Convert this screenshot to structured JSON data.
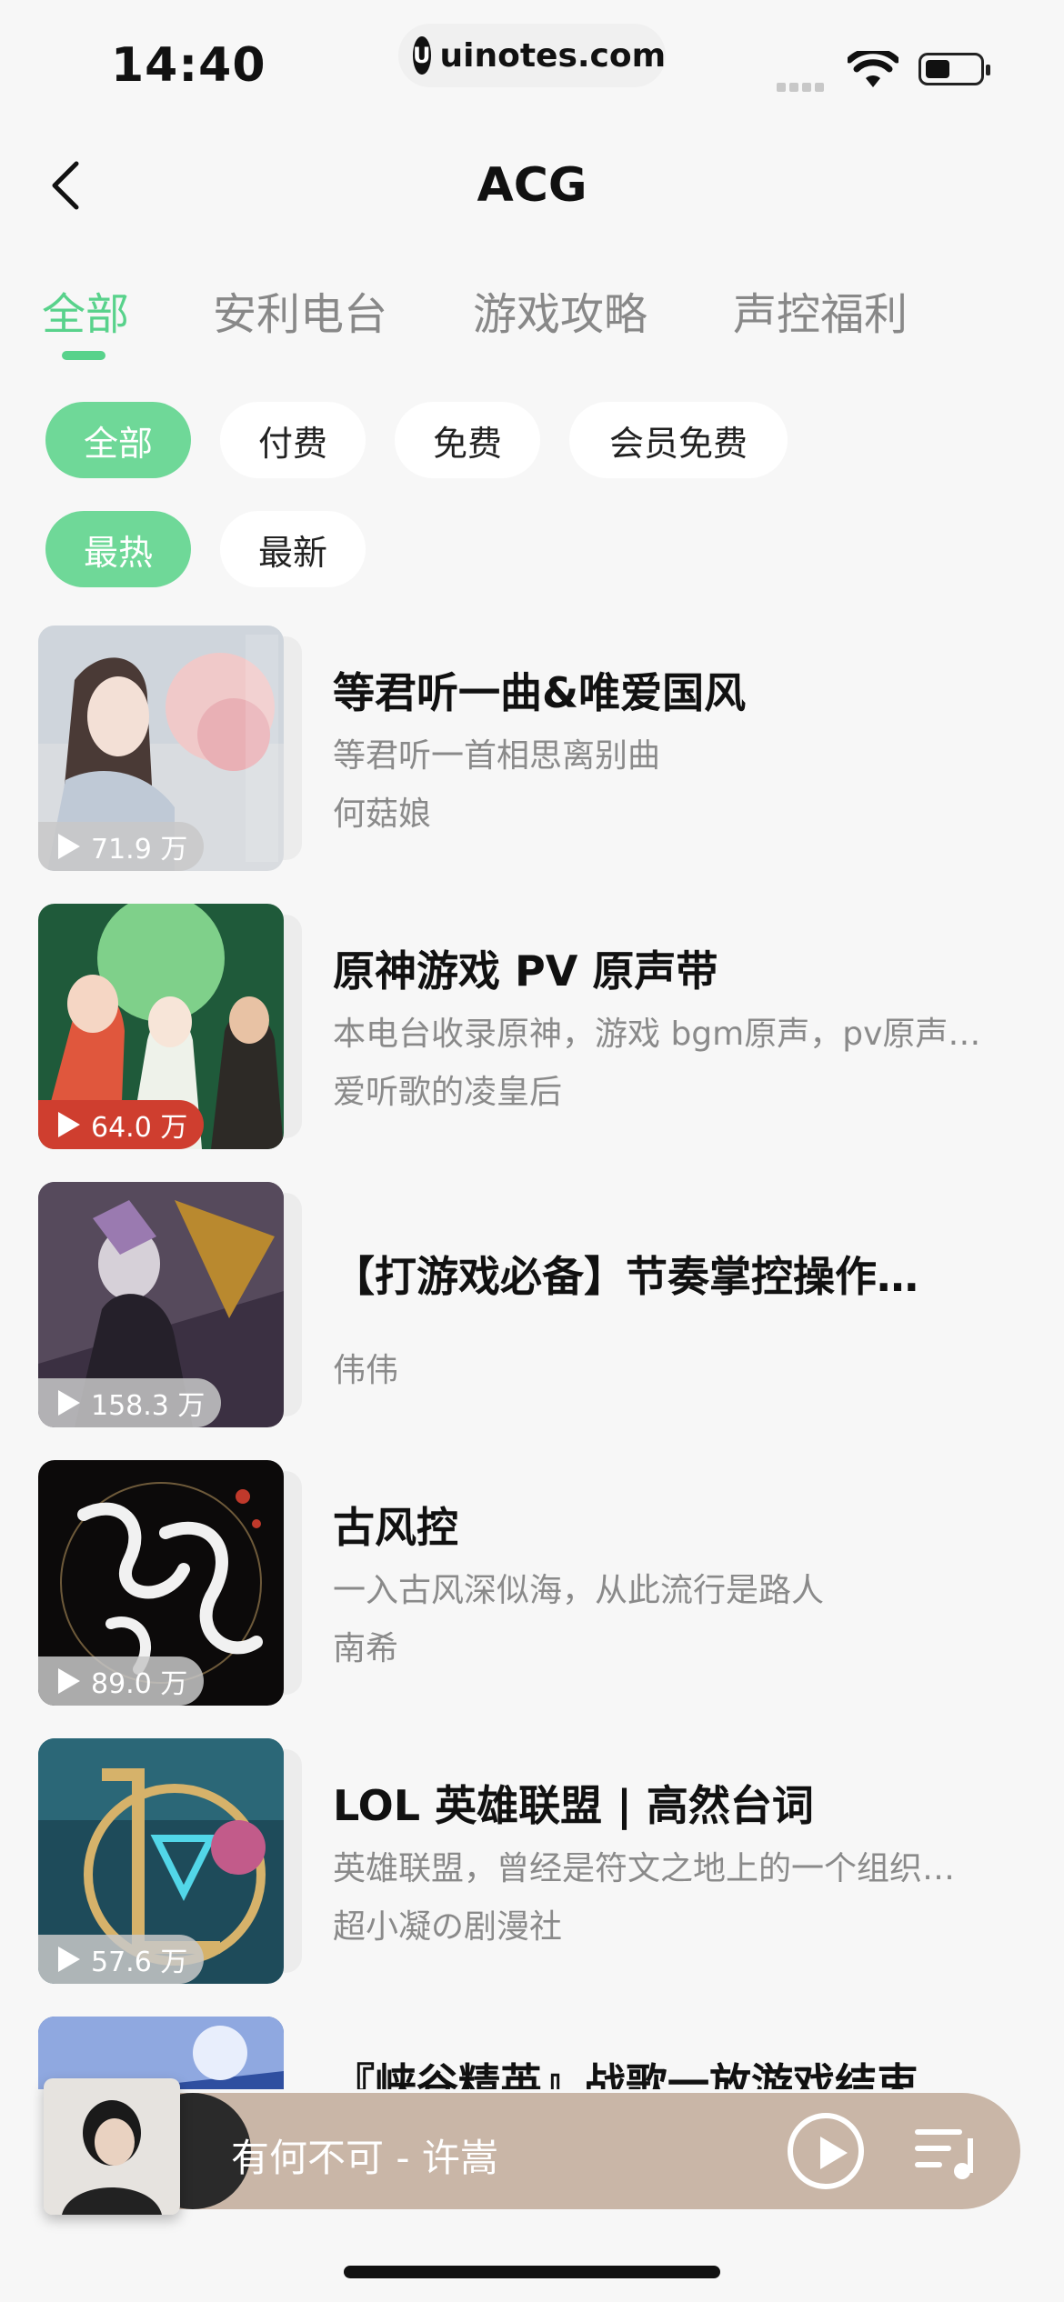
{
  "status": {
    "time": "14:40",
    "url": "uinotes.com",
    "url_logo": "U"
  },
  "nav": {
    "title": "ACG",
    "back_icon": "chevron-left-icon"
  },
  "tabs": [
    {
      "label": "全部",
      "active": true
    },
    {
      "label": "安利电台",
      "active": false
    },
    {
      "label": "游戏攻略",
      "active": false
    },
    {
      "label": "声控福利",
      "active": false
    }
  ],
  "filters": {
    "price": [
      {
        "label": "全部",
        "active": true
      },
      {
        "label": "付费",
        "active": false
      },
      {
        "label": "免费",
        "active": false
      },
      {
        "label": "会员免费",
        "active": false
      }
    ],
    "sort": [
      {
        "label": "最热",
        "active": true
      },
      {
        "label": "最新",
        "active": false
      }
    ]
  },
  "items": [
    {
      "title": "等君听一曲&唯爱国风",
      "desc": "等君听一首相思离别曲",
      "author": "何菇娘",
      "plays": "71.9 万",
      "hot": false
    },
    {
      "title": "原神游戏 PV 原声带",
      "desc": "本电台收录原神，游戏 bgm原声，pv原声…",
      "author": "爱听歌的凌皇后",
      "plays": "64.0 万",
      "hot": true
    },
    {
      "title": "【打游戏必备】节奏掌控操作…",
      "desc": "",
      "author": "伟伟",
      "plays": "158.3 万",
      "hot": false
    },
    {
      "title": "古风控",
      "desc": "一入古风深似海，从此流行是路人",
      "author": "南希",
      "plays": "89.0 万",
      "hot": false
    },
    {
      "title": "LOL 英雄联盟 | 高然台词",
      "desc": "英雄联盟，曾经是符文之地上的一个组织…",
      "author": "超小凝の剧漫社",
      "plays": "57.6 万",
      "hot": false
    },
    {
      "title": "『峡谷精英』战歌一放游戏结束",
      "desc": "",
      "author": "",
      "plays": "",
      "hot": false
    }
  ],
  "player": {
    "song": "有何不可 - 许嵩"
  },
  "colors": {
    "accent": "#58d28b",
    "chip_active": "#6fd898",
    "hot_badge": "#cf3e2f",
    "player_bg": "#c9b6a7"
  }
}
